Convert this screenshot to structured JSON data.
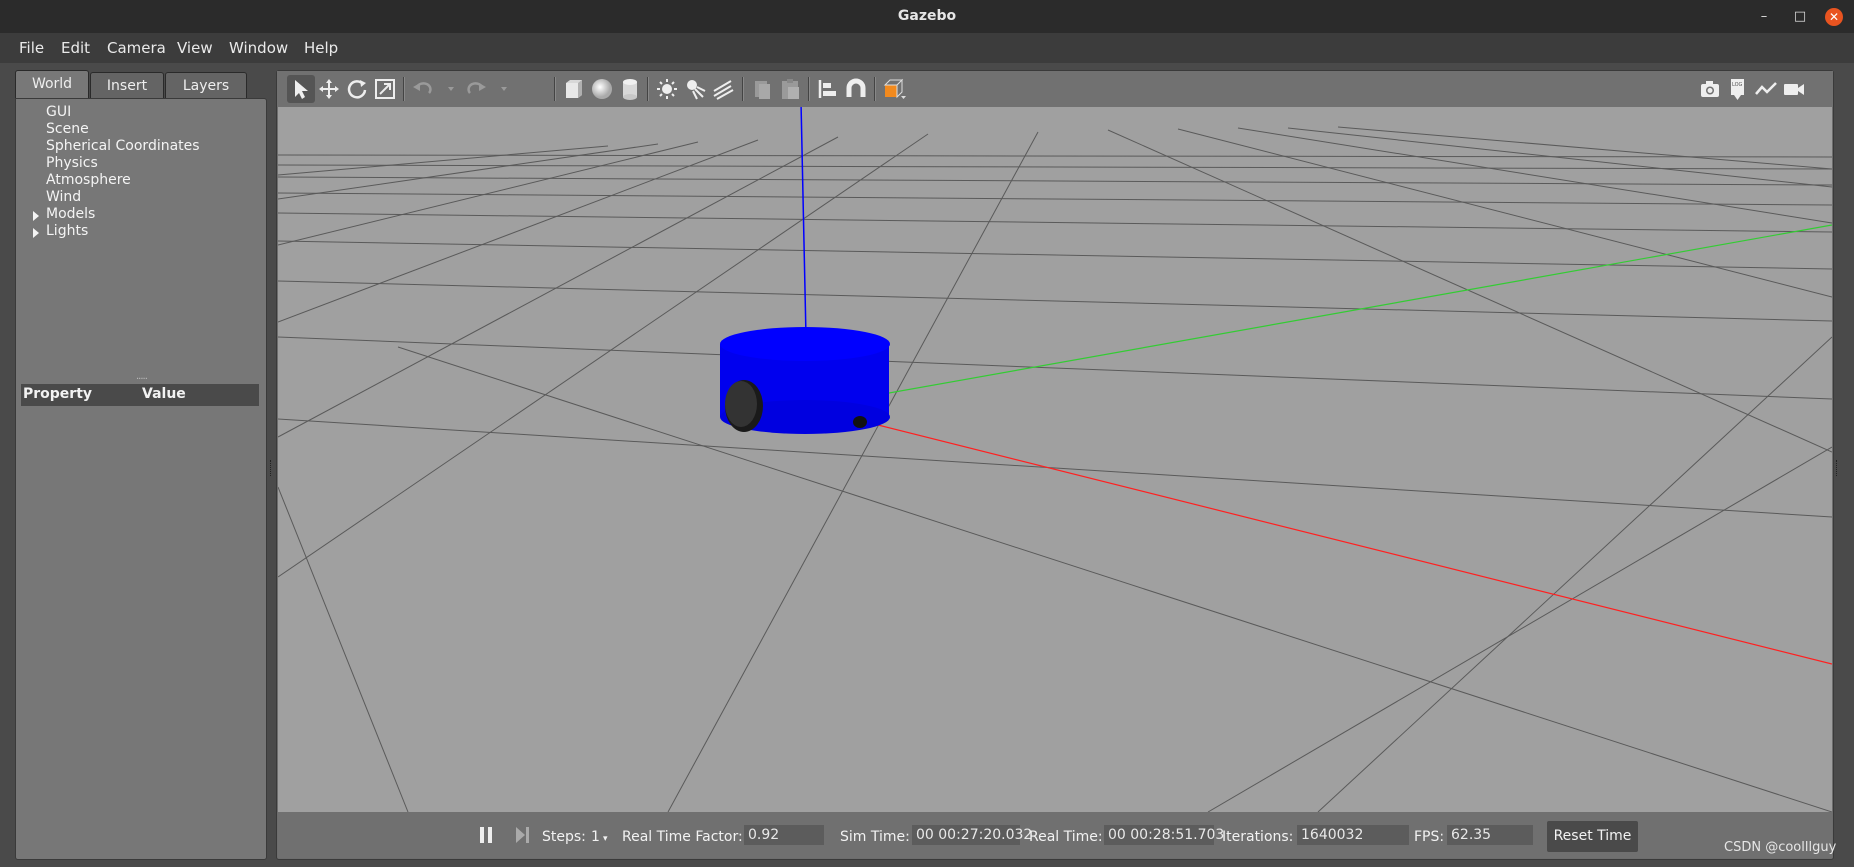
{
  "window": {
    "title": "Gazebo"
  },
  "menubar": {
    "items": [
      "File",
      "Edit",
      "Camera",
      "View",
      "Window",
      "Help"
    ]
  },
  "left_panel": {
    "tabs": [
      "World",
      "Insert",
      "Layers"
    ],
    "active_tab": "World",
    "tree": [
      {
        "label": "GUI",
        "expandable": false
      },
      {
        "label": "Scene",
        "expandable": false
      },
      {
        "label": "Spherical Coordinates",
        "expandable": false
      },
      {
        "label": "Physics",
        "expandable": false
      },
      {
        "label": "Atmosphere",
        "expandable": false
      },
      {
        "label": "Wind",
        "expandable": false
      },
      {
        "label": "Models",
        "expandable": true
      },
      {
        "label": "Lights",
        "expandable": true
      }
    ],
    "property_header": {
      "property": "Property",
      "value": "Value"
    }
  },
  "toolbar": {
    "left_icons": [
      "select-arrow-icon",
      "translate-icon",
      "rotate-icon",
      "scale-icon",
      "undo-icon",
      "undo-dropdown-icon",
      "redo-icon",
      "redo-dropdown-icon",
      "box-shape-icon",
      "sphere-shape-icon",
      "cylinder-shape-icon",
      "point-light-icon",
      "spot-light-icon",
      "directional-light-icon",
      "copy-icon",
      "paste-icon",
      "align-icon",
      "snap-magnet-icon",
      "view-angle-icon"
    ],
    "right_icons": [
      "screenshot-camera-icon",
      "log-icon",
      "plot-icon",
      "video-record-icon"
    ]
  },
  "status": {
    "steps_label": "Steps:",
    "steps_value": "1",
    "rtf_label": "Real Time Factor:",
    "rtf_value": "0.92",
    "sim_label": "Sim Time:",
    "sim_value": "00 00:27:20.032",
    "real_label": "Real Time:",
    "real_value": "00 00:28:51.703",
    "iter_label": "Iterations:",
    "iter_value": "1640032",
    "fps_label": "FPS:",
    "fps_value": "62.35",
    "reset_label": "Reset Time"
  },
  "watermark": "CSDN @coolllguy",
  "colors": {
    "robot_body": "#0000ff",
    "x_axis": "#ff0000",
    "y_axis": "#00cc00",
    "z_axis": "#0000ff",
    "close_button": "#e95420",
    "viewport_bg": "#a0a0a0"
  }
}
